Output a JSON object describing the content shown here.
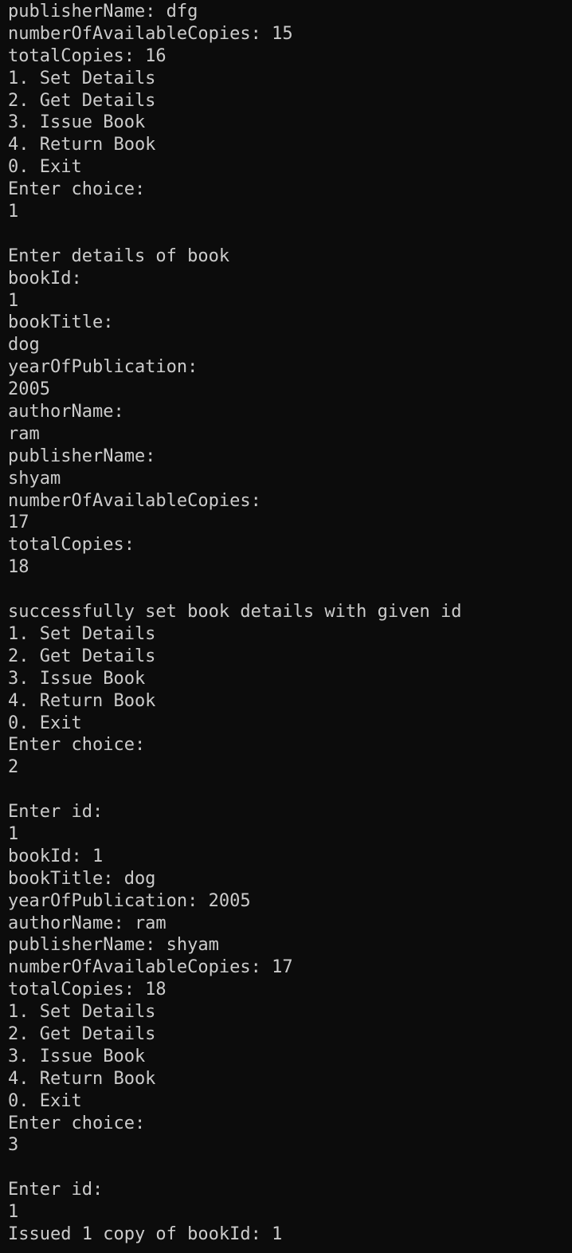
{
  "terminal": {
    "lines": [
      "publisherName: dfg",
      "numberOfAvailableCopies: 15",
      "totalCopies: 16",
      "1. Set Details",
      "2. Get Details",
      "3. Issue Book",
      "4. Return Book",
      "0. Exit",
      "Enter choice:",
      "1",
      "",
      "Enter details of book",
      "bookId:",
      "1",
      "bookTitle:",
      "dog",
      "yearOfPublication:",
      "2005",
      "authorName:",
      "ram",
      "publisherName:",
      "shyam",
      "numberOfAvailableCopies:",
      "17",
      "totalCopies:",
      "18",
      "",
      "successfully set book details with given id",
      "1. Set Details",
      "2. Get Details",
      "3. Issue Book",
      "4. Return Book",
      "0. Exit",
      "Enter choice:",
      "2",
      "",
      "Enter id:",
      "1",
      "bookId: 1",
      "bookTitle: dog",
      "yearOfPublication: 2005",
      "authorName: ram",
      "publisherName: shyam",
      "numberOfAvailableCopies: 17",
      "totalCopies: 18",
      "1. Set Details",
      "2. Get Details",
      "3. Issue Book",
      "4. Return Book",
      "0. Exit",
      "Enter choice:",
      "3",
      "",
      "Enter id:",
      "1",
      "Issued 1 copy of bookId: 1"
    ]
  }
}
